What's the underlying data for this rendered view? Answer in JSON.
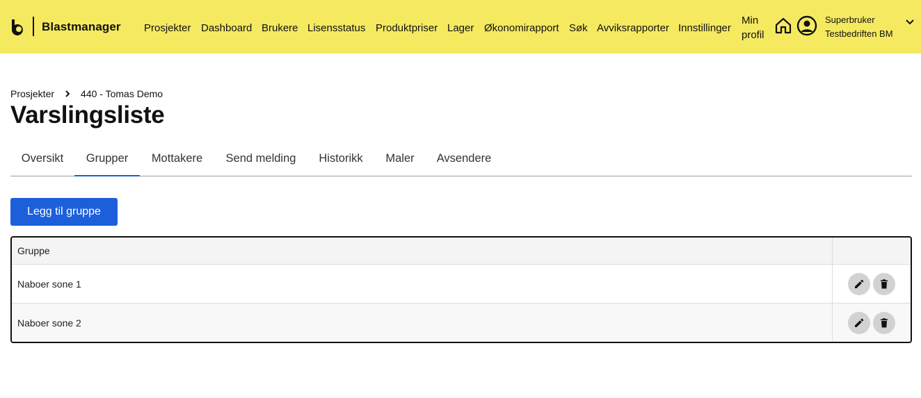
{
  "header": {
    "brand": "Blastmanager",
    "nav": [
      "Prosjekter",
      "Dashboard",
      "Brukere",
      "Lisensstatus",
      "Produktpriser",
      "Lager",
      "Økonomirapport",
      "Søk",
      "Avviksrapporter",
      "Innstillinger"
    ],
    "profile_line1": "Min",
    "profile_line2": "profil",
    "user_role": "Superbruker",
    "user_company": "Testbedriften BM",
    "icons": [
      "logo-icon",
      "home-icon",
      "user-circle-icon",
      "chevron-down-icon"
    ],
    "bg_color": "#f5e960"
  },
  "breadcrumb": {
    "items": [
      "Prosjekter",
      "440 - Tomas Demo"
    ]
  },
  "page": {
    "title": "Varslingsliste"
  },
  "tabs": {
    "items": [
      "Oversikt",
      "Grupper",
      "Mottakere",
      "Send melding",
      "Historikk",
      "Maler",
      "Avsendere"
    ],
    "active": "Grupper",
    "accent_color": "#1a5fd8"
  },
  "actions": {
    "add_group": "Legg til gruppe",
    "button_color": "#1d5fdb"
  },
  "table": {
    "columns": [
      "Gruppe",
      ""
    ],
    "rows": [
      {
        "name": "Naboer sone 1",
        "actions": [
          "edit-icon",
          "delete-icon"
        ]
      },
      {
        "name": "Naboer sone 2",
        "actions": [
          "edit-icon",
          "delete-icon"
        ]
      }
    ]
  }
}
